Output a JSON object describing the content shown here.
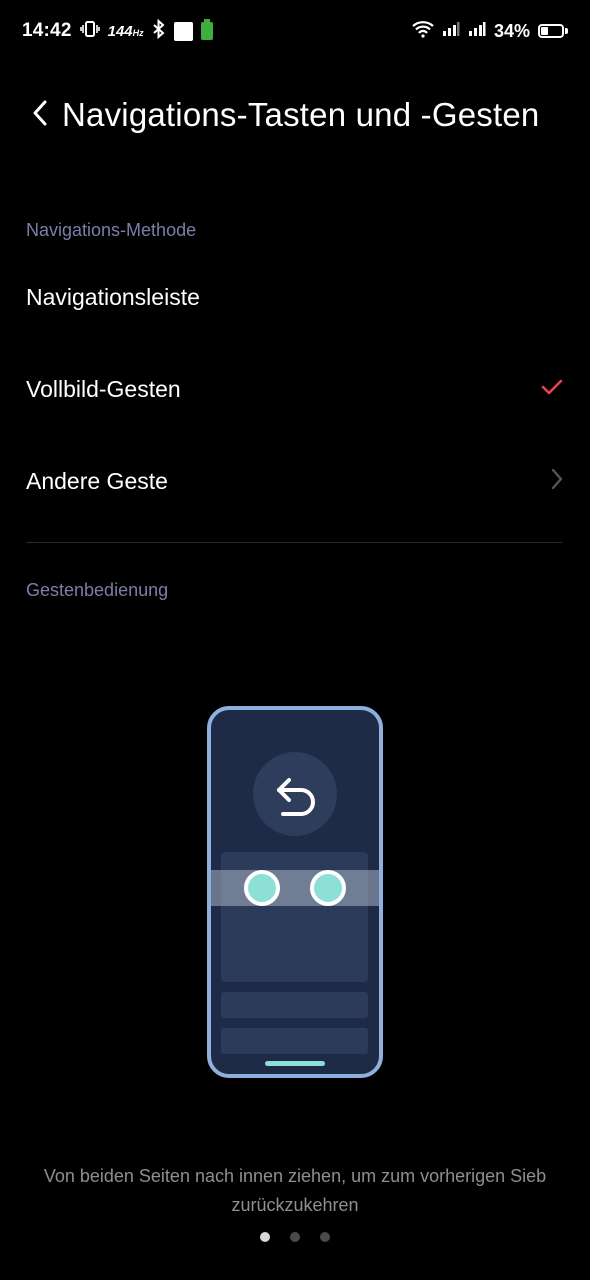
{
  "status_bar": {
    "time": "14:42",
    "refresh_rate": "144",
    "refresh_unit": "Hz",
    "battery_percent": "34%",
    "battery_level": 0.34
  },
  "header": {
    "back_icon": "chevron-left-icon",
    "title": "Navigations-Tasten und -Gesten"
  },
  "sections": {
    "method_label": "Navigations-Methode",
    "gesture_label": "Gestenbedienung"
  },
  "options": [
    {
      "label": "Navigationsleiste",
      "selected": false
    },
    {
      "label": "Vollbild-Gesten",
      "selected": true,
      "icon": "checkmark-icon"
    },
    {
      "label": "Andere Geste",
      "icon": "chevron-right-icon"
    }
  ],
  "colors": {
    "background": "#000000",
    "accent_check": "#e8434b",
    "section_label": "#7b7ea8",
    "phone_frame": "#8fb0dc",
    "phone_screen": "#1e2b47",
    "touch_dot": "#8ce0d6"
  },
  "illustration": {
    "icon": "back-arrow-icon"
  },
  "description": {
    "line1": "Von beiden Seiten nach innen ziehen, um zum vorherigen Sieb",
    "line2": "zurückzukehren"
  },
  "pager": {
    "count": 3,
    "active_index": 0
  }
}
